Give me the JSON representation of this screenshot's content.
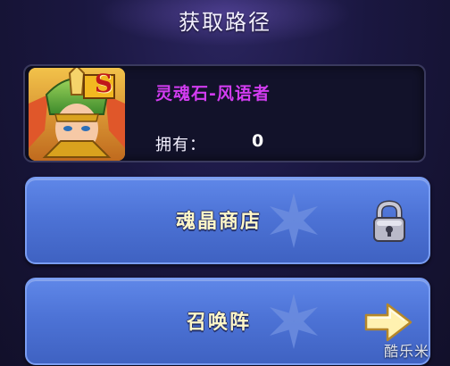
{
  "panel": {
    "title": "获取路径"
  },
  "item": {
    "name": "灵魂石-风语者",
    "owned_label": "拥有：",
    "owned_value": "0",
    "icon": "hero-portrait-icon",
    "badge": "S",
    "name_color": "#d23cf0"
  },
  "routes": [
    {
      "label": "魂晶商店",
      "icon": "lock-icon",
      "locked": true
    },
    {
      "label": "召唤阵",
      "icon": "arrow-right-icon",
      "locked": false
    }
  ],
  "watermark": "酷乐米",
  "colors": {
    "button_blue": "#4d73d6",
    "label_text": "#fff7c8",
    "background": "#1a1740"
  }
}
